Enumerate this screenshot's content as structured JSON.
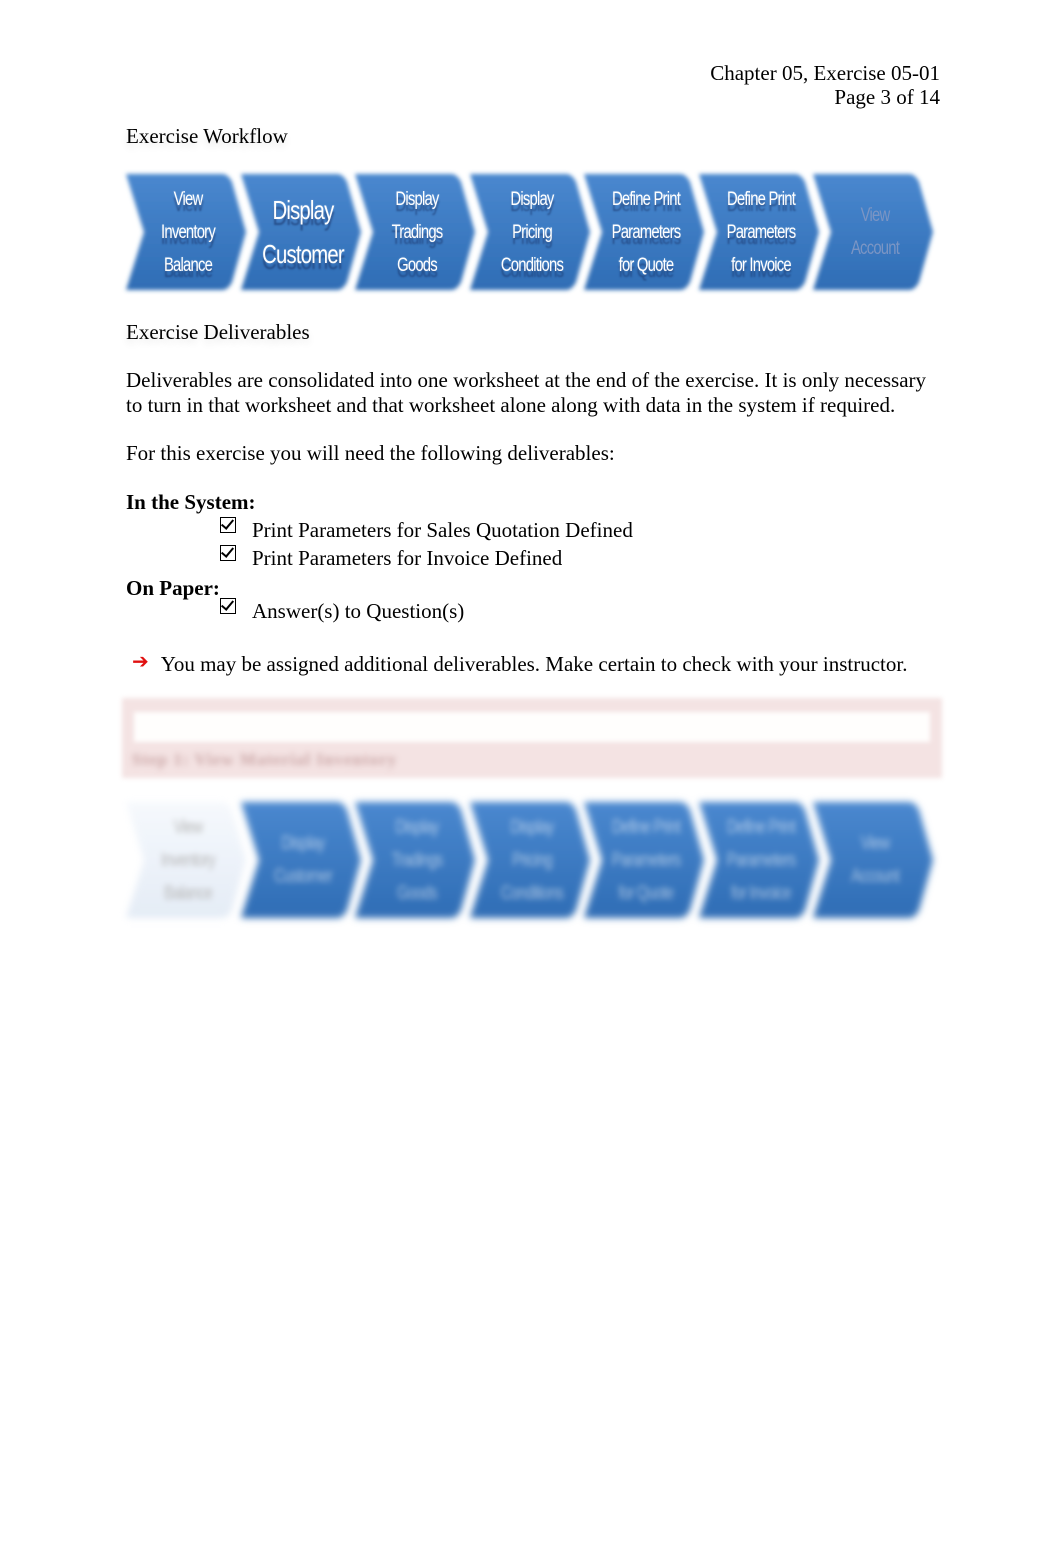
{
  "header": {
    "chapter_exercise": "Chapter 05, Exercise 05-01",
    "page": "Page 3 of 14"
  },
  "workflow_section": {
    "title": "Exercise Workflow",
    "steps": [
      {
        "label": "View Inventory Balance",
        "state": "normal"
      },
      {
        "label": "Display Customer",
        "state": "current"
      },
      {
        "label": "Display Tradings Goods",
        "state": "normal"
      },
      {
        "label": "Display Pricing Conditions",
        "state": "normal"
      },
      {
        "label": "Define Print Parameters for Quote",
        "state": "normal"
      },
      {
        "label": "Define Print Parameters for Invoice",
        "state": "normal"
      },
      {
        "label": "View Account",
        "state": "dimmed"
      }
    ]
  },
  "deliverables_section": {
    "title": "Exercise Deliverables",
    "intro": "Deliverables are consolidated into one worksheet at the end of the exercise. It is only necessary to turn in that worksheet and that worksheet alone along with data in the system if required.",
    "lead_in": "For this exercise you will need the following deliverables:",
    "in_system_heading": "In the System:",
    "in_system_items": [
      "Print Parameters for Sales Quotation Defined",
      "Print Parameters for Invoice Defined"
    ],
    "on_paper_heading": "On Paper:",
    "on_paper_items": [
      "Answer(s) to Question(s)"
    ],
    "note_icon": "red-arrow-icon",
    "note": "You may be assigned additional deliverables. Make certain to check with your instructor."
  },
  "blurred_step": {
    "title": "Step 1: View Material Inventory"
  },
  "colors": {
    "chevron_blue": "#2f6db5",
    "chevron_light": "#4a88cf",
    "note_arrow": "#e01010",
    "step_banner": "#f4e3e3"
  }
}
